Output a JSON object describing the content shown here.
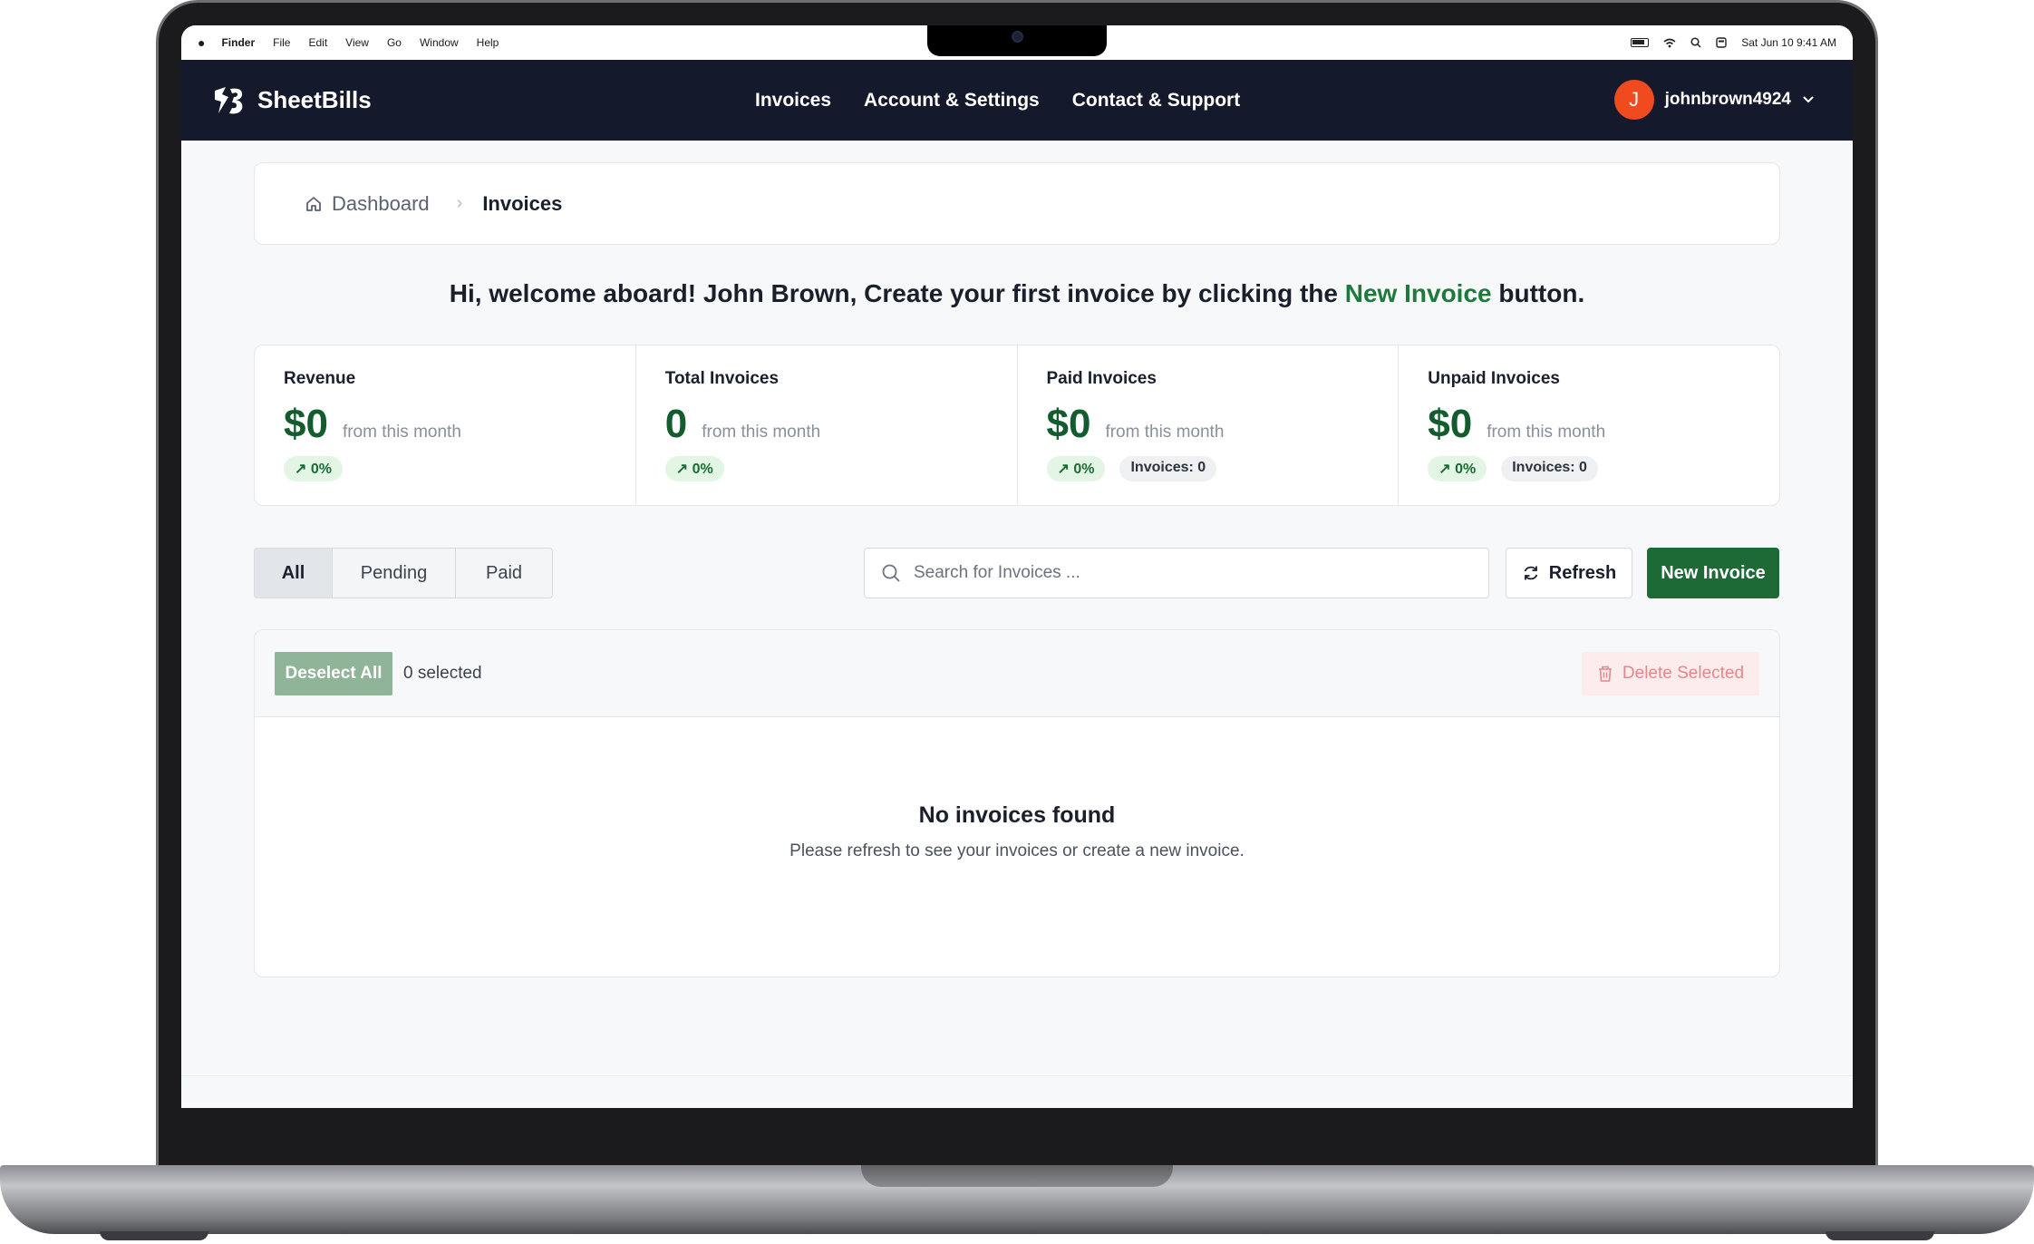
{
  "menubar": {
    "apple": "",
    "items": [
      "Finder",
      "File",
      "Edit",
      "View",
      "Go",
      "Window",
      "Help"
    ],
    "datetime": "Sat Jun 10  9:41 AM"
  },
  "brand": {
    "name": "SheetBills"
  },
  "nav": {
    "invoices": "Invoices",
    "account": "Account & Settings",
    "support": "Contact & Support"
  },
  "user": {
    "initial": "J",
    "username": "johnbrown4924"
  },
  "breadcrumb": {
    "home": "Dashboard",
    "current": "Invoices"
  },
  "welcome": {
    "before": "Hi, welcome aboard! John Brown, Create your first invoice by clicking the ",
    "accent": "New Invoice",
    "after": " button."
  },
  "stats": [
    {
      "label": "Revenue",
      "value": "$0",
      "sub": "from this month",
      "change": "0%",
      "extra": ""
    },
    {
      "label": "Total Invoices",
      "value": "0",
      "sub": "from this month",
      "change": "0%",
      "extra": ""
    },
    {
      "label": "Paid Invoices",
      "value": "$0",
      "sub": "from this month",
      "change": "0%",
      "extra": "Invoices: 0"
    },
    {
      "label": "Unpaid Invoices",
      "value": "$0",
      "sub": "from this month",
      "change": "0%",
      "extra": "Invoices: 0"
    }
  ],
  "filters": {
    "all": "All",
    "pending": "Pending",
    "paid": "Paid"
  },
  "search": {
    "placeholder": "Search for Invoices ..."
  },
  "actions": {
    "refresh": "Refresh",
    "new_invoice": "New Invoice"
  },
  "list": {
    "deselect": "Deselect All",
    "selected": "0 selected",
    "delete": "Delete Selected",
    "empty_title": "No invoices found",
    "empty_sub": "Please refresh to see your invoices or create a new invoice."
  },
  "colors": {
    "brand_green": "#1d6a36",
    "header_bg": "#141a2b",
    "avatar": "#f04a1f"
  }
}
